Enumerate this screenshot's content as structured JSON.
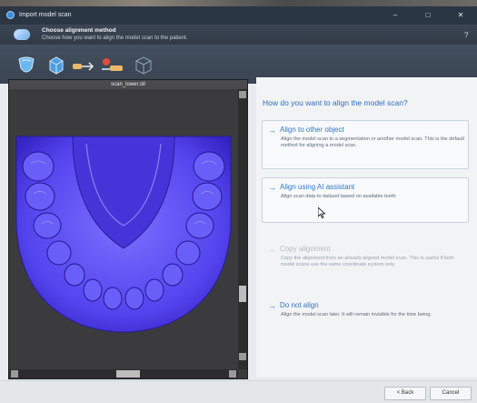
{
  "window": {
    "title": "Import model scan",
    "controls": {
      "minimize": "–",
      "maximize": "□",
      "close": "✕"
    }
  },
  "header": {
    "step_title": "Choose alignment method",
    "step_subtitle": "Choose how you want to align the model scan to the patient.",
    "help": "?"
  },
  "toolbar": {
    "icons": [
      "tooth-icon",
      "cube-icon",
      "arrow-tool-icon",
      "move-tool-icon",
      "wireframe-cube-icon"
    ]
  },
  "viewport": {
    "title": "scan_lower.stl",
    "model_color": "#5a4cf0"
  },
  "panel": {
    "question": "How do you want to align the model scan?",
    "options": [
      {
        "arrow": "→",
        "title": "Align to other object",
        "description": "Align the model scan to a segmentation or another model scan. This is the default method for aligning a model scan."
      },
      {
        "arrow": "→",
        "title": "Align using AI assistant",
        "description": "Align scan data to dataset based on available teeth"
      },
      {
        "arrow": "→",
        "title": "Copy alignment",
        "description": "Copy the alignment from an already aligned model scan. This is useful if both model scans use the same coordinate system only."
      },
      {
        "arrow": "→",
        "title": "Do not align",
        "description": "Align the model scan later. It will remain invisible for the time being."
      }
    ]
  },
  "footer": {
    "back_label": "< Back",
    "cancel_label": "Cancel"
  }
}
